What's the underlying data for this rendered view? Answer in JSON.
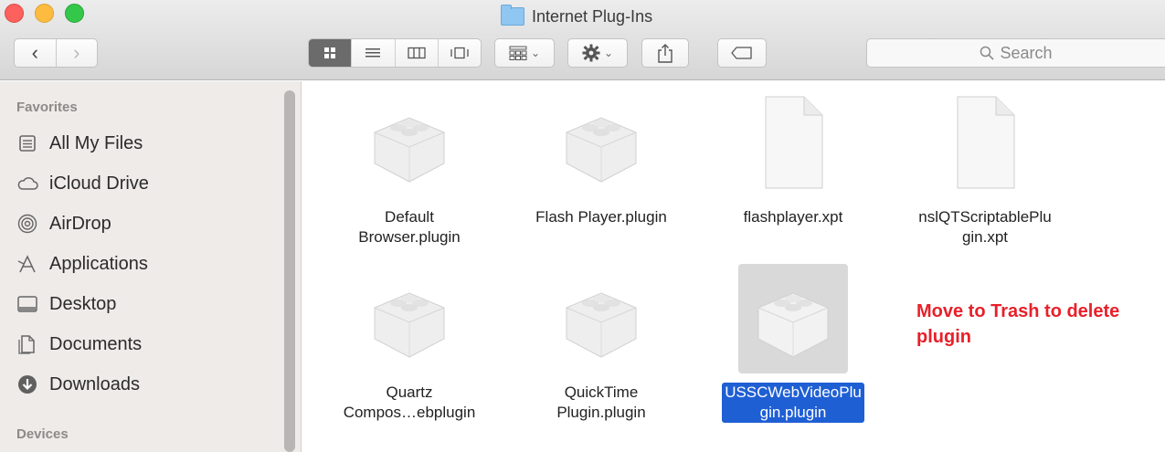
{
  "window": {
    "title": "Internet Plug-Ins"
  },
  "toolbar": {
    "back_glyph": "‹",
    "forward_glyph": "›",
    "view_icons": [
      "icon-view-icon",
      "list-view-icon",
      "column-view-icon",
      "coverflow-view-icon"
    ],
    "arrange_chevron": "⌄",
    "action_chevron": "⌄",
    "search_placeholder": "Search"
  },
  "sidebar": {
    "sections": [
      {
        "header": "Favorites"
      },
      {
        "header": "Devices"
      }
    ],
    "items": [
      {
        "label": "All My Files",
        "icon": "all-files-icon"
      },
      {
        "label": "iCloud Drive",
        "icon": "cloud-icon"
      },
      {
        "label": "AirDrop",
        "icon": "airdrop-icon"
      },
      {
        "label": "Applications",
        "icon": "applications-icon"
      },
      {
        "label": "Desktop",
        "icon": "desktop-icon"
      },
      {
        "label": "Documents",
        "icon": "documents-icon"
      },
      {
        "label": "Downloads",
        "icon": "downloads-icon"
      }
    ]
  },
  "files": [
    {
      "line1": "Default",
      "line2": "Browser.plugin",
      "kind": "plugin"
    },
    {
      "line1": "Flash Player.plugin",
      "line2": "",
      "kind": "plugin"
    },
    {
      "line1": "flashplayer.xpt",
      "line2": "",
      "kind": "document"
    },
    {
      "line1": "nslQTScriptablePlu",
      "line2": "gin.xpt",
      "kind": "document"
    },
    {
      "line1": "Quartz",
      "line2": "Compos…ebplugin",
      "kind": "plugin"
    },
    {
      "line1": "QuickTime",
      "line2": "Plugin.plugin",
      "kind": "plugin"
    },
    {
      "line1": "USSCWebVideoPlu",
      "line2": "gin.plugin",
      "kind": "plugin",
      "selected": true
    }
  ],
  "annotation": {
    "line1": "Move to Trash to delete",
    "line2": "plugin"
  },
  "colors": {
    "selection": "#1f5fd4",
    "annotation": "#e8202a",
    "sidebar_bg": "#eeebe9"
  }
}
